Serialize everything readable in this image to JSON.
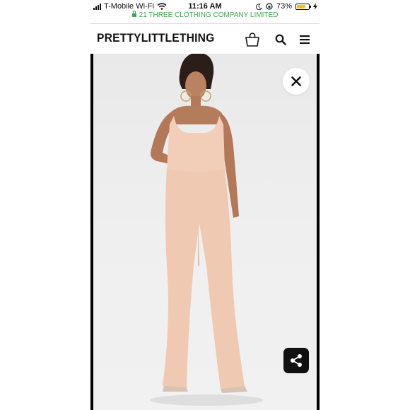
{
  "status_bar": {
    "carrier": "T-Mobile Wi-Fi",
    "time": "11:16 AM",
    "battery_percent": "73%",
    "battery_level": 0.73,
    "icons": [
      "signal-icon",
      "wifi-icon",
      "moon-icon",
      "rotation-lock-icon",
      "battery-icon",
      "charging-icon"
    ]
  },
  "url_bar": {
    "secure_site_name": "21 THREE CLOTHING COMPANY LIMITED",
    "color": "#3aa64a"
  },
  "header": {
    "logo": "PRETTYLITTLETHING",
    "icons": [
      "bag-icon",
      "search-icon",
      "menu-icon"
    ]
  },
  "viewer": {
    "image": "product-photo",
    "close_icon": "close-icon",
    "share_icon": "share-icon"
  },
  "colors": {
    "garment": "#f2cdb8",
    "background": "#ececec",
    "share_button": "#111111"
  }
}
